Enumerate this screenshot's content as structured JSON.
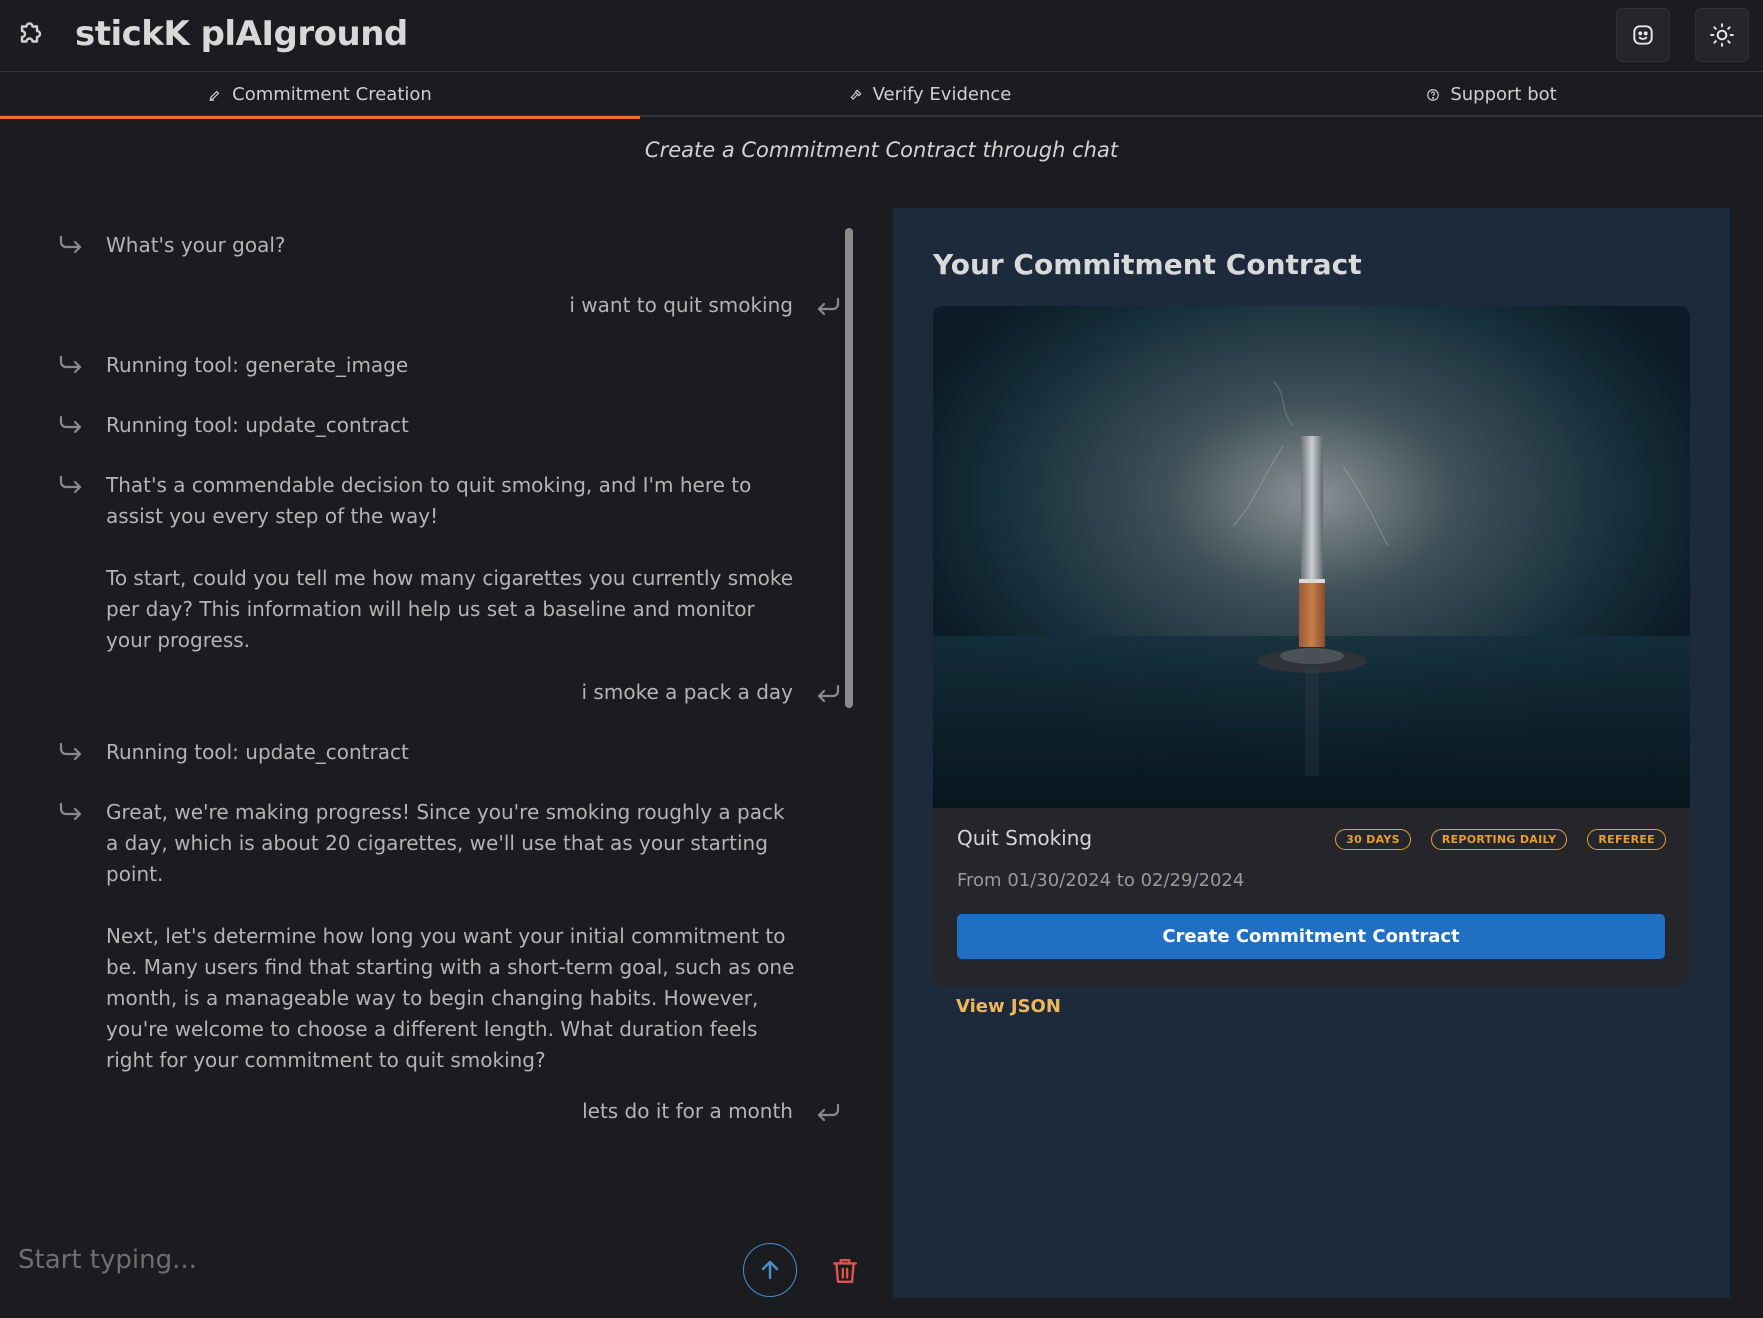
{
  "app": {
    "title": "stickK plAIground",
    "logo_icon": "puzzle-icon",
    "profile_icon": "face-icon",
    "theme_icon": "sun-icon"
  },
  "tabs": [
    {
      "label": "Commitment Creation",
      "icon": "pen-icon",
      "active": true
    },
    {
      "label": "Verify Evidence",
      "icon": "hammer-icon",
      "active": false
    },
    {
      "label": "Support bot",
      "icon": "help-icon",
      "active": false
    }
  ],
  "subtitle": "Create a Commitment Contract through chat",
  "chat": {
    "messages": [
      {
        "role": "bot",
        "text": "What's your goal?"
      },
      {
        "role": "user",
        "text": "i want to quit smoking"
      },
      {
        "role": "bot",
        "text": "Running tool: generate_image"
      },
      {
        "role": "bot",
        "text": "Running tool: update_contract"
      },
      {
        "role": "bot",
        "paragraphs": [
          "That's a commendable decision to quit smoking, and I'm here to assist you every step of the way!",
          "To start, could you tell me how many cigarettes you currently smoke per day? This information will help us set a baseline and monitor your progress."
        ]
      },
      {
        "role": "user",
        "text": "i smoke a pack a day"
      },
      {
        "role": "bot",
        "text": "Running tool: update_contract"
      },
      {
        "role": "bot",
        "paragraphs": [
          "Great, we're making progress! Since you're smoking roughly a pack a day, which is about 20 cigarettes, we'll use that as your starting point.",
          "Next, let's determine how long you want your initial commitment to be. Many users find that starting with a short-term goal, such as one month, is a manageable way to begin changing habits. However, you're welcome to choose a different length. What duration feels right for your commitment to quit smoking?"
        ]
      },
      {
        "role": "user",
        "text": "lets do it for a month"
      }
    ],
    "input_placeholder": "Start typing...",
    "send_icon": "arrow-up-icon",
    "delete_icon": "trash-icon"
  },
  "contract": {
    "heading": "Your Commitment Contract",
    "image": "cigarette-photo",
    "name": "Quit Smoking",
    "badges": [
      "30 DAYS",
      "REPORTING DAILY",
      "REFEREE"
    ],
    "dates": "From 01/30/2024 to 02/29/2024",
    "create_button": "Create Commitment Contract",
    "view_json": "View JSON"
  },
  "colors": {
    "accent_tab": "#e8702a",
    "badge": "#e89d32",
    "button": "#1f6fc5",
    "link": "#f0b65a",
    "panel": "#1d2a3b"
  }
}
